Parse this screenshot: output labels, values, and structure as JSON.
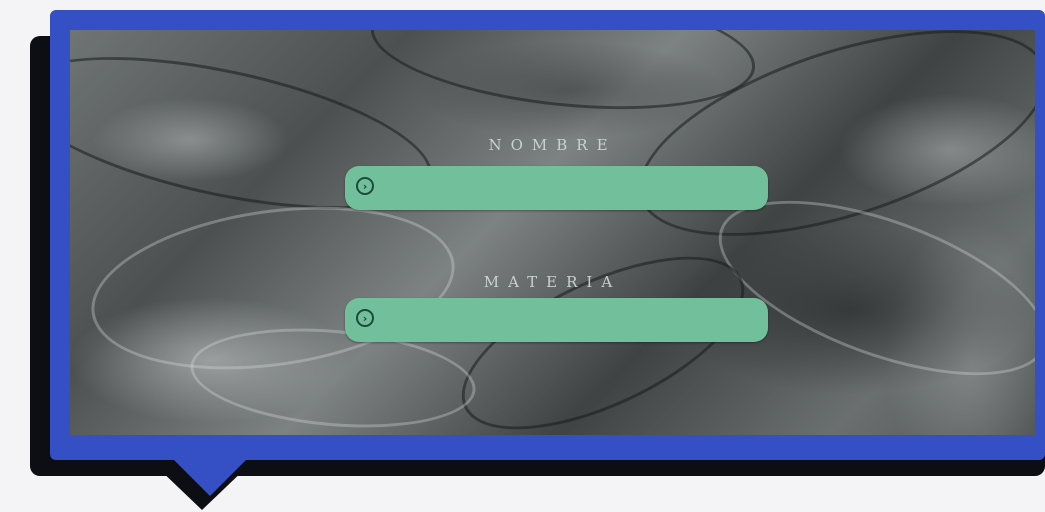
{
  "card": {
    "fields": [
      {
        "label": "NOMBRE",
        "value": "",
        "icon": "chevron-right-icon"
      },
      {
        "label": "MATERIA",
        "value": "",
        "icon": "chevron-right-icon"
      }
    ]
  },
  "colors": {
    "frame": "#3550c4",
    "shadow": "#0d0d14",
    "field": "#72bf9c",
    "label": "#c9d1cf"
  }
}
